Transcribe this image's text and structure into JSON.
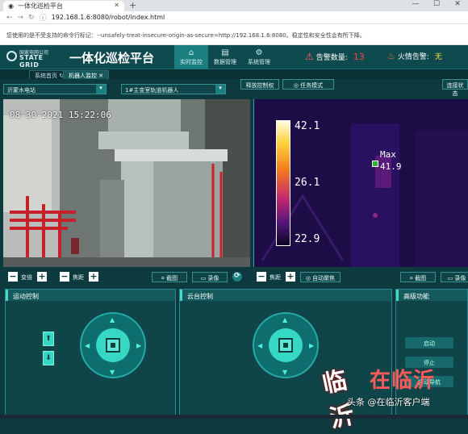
{
  "browser": {
    "tab_title": "一体化巡检平台",
    "url": "192.168.1.6:8080/robot/index.html",
    "warning": "您使用的是不受支持的命令行标记：--unsafely-treat-insecure-origin-as-secure=http://192.168.1.6:8080。稳定性和安全性会有所下降。"
  },
  "header": {
    "logo_line1": "国家电网公司",
    "logo_line2": "STATE GRID",
    "app_title": "一体化巡检平台",
    "nav": [
      "实时监控",
      "数据管理",
      "系统管理"
    ],
    "alarm_label": "告警数量:",
    "alarm_count": "13",
    "fire_label": "火情告警:",
    "fire_value": "无"
  },
  "subtabs": [
    "系统首页",
    "机器人监控"
  ],
  "controls": {
    "station": "沂蒙水电站",
    "robot": "1#主变室轨道机器人",
    "release_btn": "释放控制权",
    "task_btn": "任务模式",
    "connect_status": "连接状态"
  },
  "visible_cam": {
    "timestamp": "08-30-2021 15:22:06"
  },
  "thermal_cam": {
    "scale_max": "42.1",
    "scale_mid": "26.1",
    "scale_min": "22.9",
    "max_label": "Max",
    "max_value": "41.9"
  },
  "toolbar": {
    "zoom": "变倍",
    "focus": "焦距",
    "snapshot": "截图",
    "record": "录像",
    "autofocus": "自动聚焦"
  },
  "panels": {
    "motion": "运动控制",
    "ptz": "云台控制",
    "advanced": "高级功能",
    "adv_buttons": [
      "启动",
      "停止",
      "自动导航"
    ]
  },
  "watermark": {
    "site": "在临沂",
    "credit": "头条 @在临沂客户端"
  }
}
